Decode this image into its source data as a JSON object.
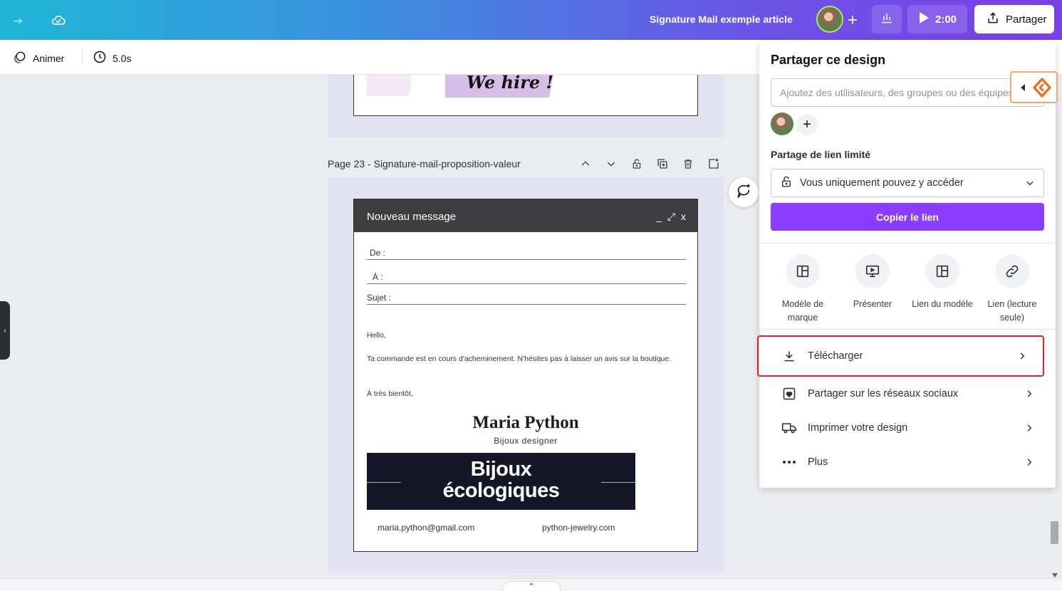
{
  "topbar": {
    "doc_title": "Signature Mail exemple article",
    "timer_label": "2:00",
    "share_label": "Partager",
    "icons": [
      "redo-icon",
      "cloud-save-icon",
      "plus-icon",
      "insights-icon",
      "play-icon",
      "upload-icon"
    ]
  },
  "toolbar": {
    "animate_label": "Animer",
    "duration_label": "5.0s"
  },
  "canvas": {
    "page_label": "Page 23 - Signature-mail-proposition-valeur",
    "prev_page_text": "We hire !",
    "message": {
      "title": "Nouveau message",
      "controls": "_ ⤢ x",
      "from_label": "De :",
      "to_label": "À :",
      "subject_label": "Sujet :",
      "greeting": "Hello,",
      "body": "Ta commande est en cours d'acheminement. N'hésites pas à laisser un avis sur la boutique.",
      "closing": "À très bientôt,",
      "sig_name": "Maria Python",
      "sig_role": "Bijoux designer",
      "banner_line1": "Bijoux",
      "banner_line2": "écologiques",
      "email": "maria.python@gmail.com",
      "website": "python-jewelry.com"
    }
  },
  "share_panel": {
    "title": "Partager ce design",
    "input_placeholder": "Ajoutez des utilisateurs, des groupes ou des équipes",
    "link_section_label": "Partage de lien limité",
    "access_value": "Vous uniquement pouvez y accéder",
    "copy_link_label": "Copier le lien",
    "options": [
      {
        "label": "Modèle de marque",
        "icon": "template-icon"
      },
      {
        "label": "Présenter",
        "icon": "present-icon"
      },
      {
        "label": "Lien du modèle",
        "icon": "template-link-icon"
      },
      {
        "label": "Lien (lecture seule)",
        "icon": "link-icon"
      }
    ],
    "rows": [
      {
        "label": "Télécharger",
        "icon": "download-icon"
      },
      {
        "label": "Partager sur les réseaux sociaux",
        "icon": "social-heart-icon"
      },
      {
        "label": "Imprimer votre design",
        "icon": "truck-icon"
      },
      {
        "label": "Plus",
        "icon": "more-dots-icon"
      }
    ]
  },
  "colors": {
    "accent": "#8b3dff",
    "highlight": "#e8202a",
    "banner": "#151729"
  }
}
